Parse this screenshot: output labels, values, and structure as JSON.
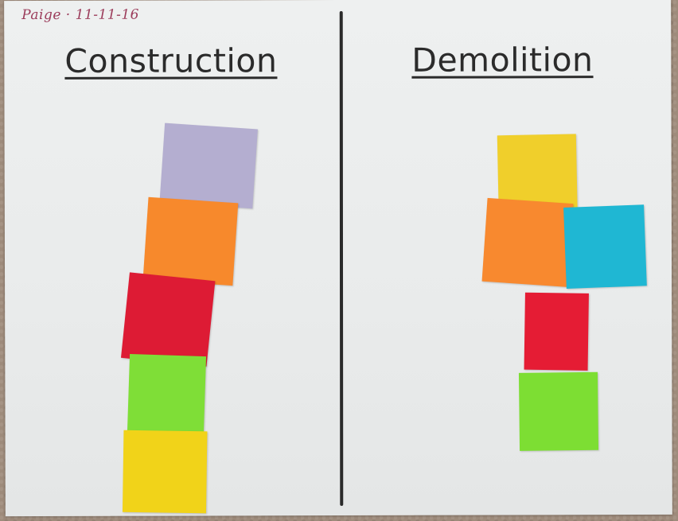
{
  "poster": {
    "name_note": "Paige · 11-11-16",
    "left_heading": "Construction",
    "right_heading": "Demolition"
  },
  "construction_notes": [
    {
      "color": "#b4aed0",
      "label": "lavender"
    },
    {
      "color": "#f7892c",
      "label": "orange"
    },
    {
      "color": "#dd1b34",
      "label": "red"
    },
    {
      "color": "#7fde37",
      "label": "green"
    },
    {
      "color": "#f1d319",
      "label": "yellow"
    }
  ],
  "demolition_notes": [
    {
      "color": "#f0cf2b",
      "label": "yellow"
    },
    {
      "color": "#f8892f",
      "label": "orange"
    },
    {
      "color": "#1fb7d3",
      "label": "cyan"
    },
    {
      "color": "#e51c34",
      "label": "red"
    },
    {
      "color": "#7dde33",
      "label": "green"
    }
  ],
  "colors": {
    "paper": "#eceeee",
    "ink": "#2b2b2b",
    "name_ink": "#9b3b5a",
    "carpet": "#9e8b7b"
  }
}
